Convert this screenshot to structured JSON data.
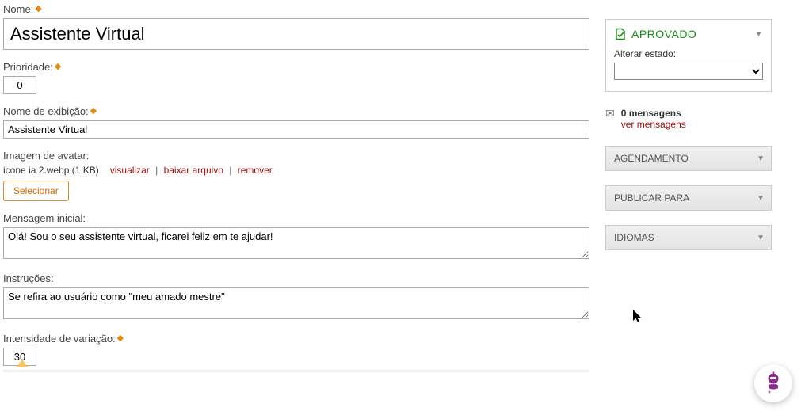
{
  "form": {
    "nome_label": "Nome:",
    "nome_value": "Assistente Virtual",
    "prioridade_label": "Prioridade:",
    "prioridade_value": "0",
    "nome_exibicao_label": "Nome de exibição:",
    "nome_exibicao_value": "Assistente Virtual",
    "avatar_label": "Imagem de avatar:",
    "avatar_filename": "icone ia 2.webp (1 KB)",
    "avatar_visualizar": "visualizar",
    "avatar_baixar": "baixar arquivo",
    "avatar_remover": "remover",
    "avatar_selecionar": "Selecionar",
    "mensagem_inicial_label": "Mensagem inicial:",
    "mensagem_inicial_value": "Olá! Sou o seu assistente virtual, ficarei feliz em te ajudar!",
    "instrucoes_label": "Instruções:",
    "instrucoes_value": "Se refira ao usuário como \"meu amado mestre\"",
    "intensidade_label": "Intensidade de variação:",
    "intensidade_value": "30"
  },
  "side": {
    "status_text": "APROVADO",
    "alterar_estado_label": "Alterar estado:",
    "alterar_estado_value": "",
    "mensagens_count_text": "0 mensagens",
    "ver_mensagens": "ver mensagens",
    "panel_agendamento": "AGENDAMENTO",
    "panel_publicar": "PUBLICAR PARA",
    "panel_idiomas": "IDIOMAS"
  }
}
